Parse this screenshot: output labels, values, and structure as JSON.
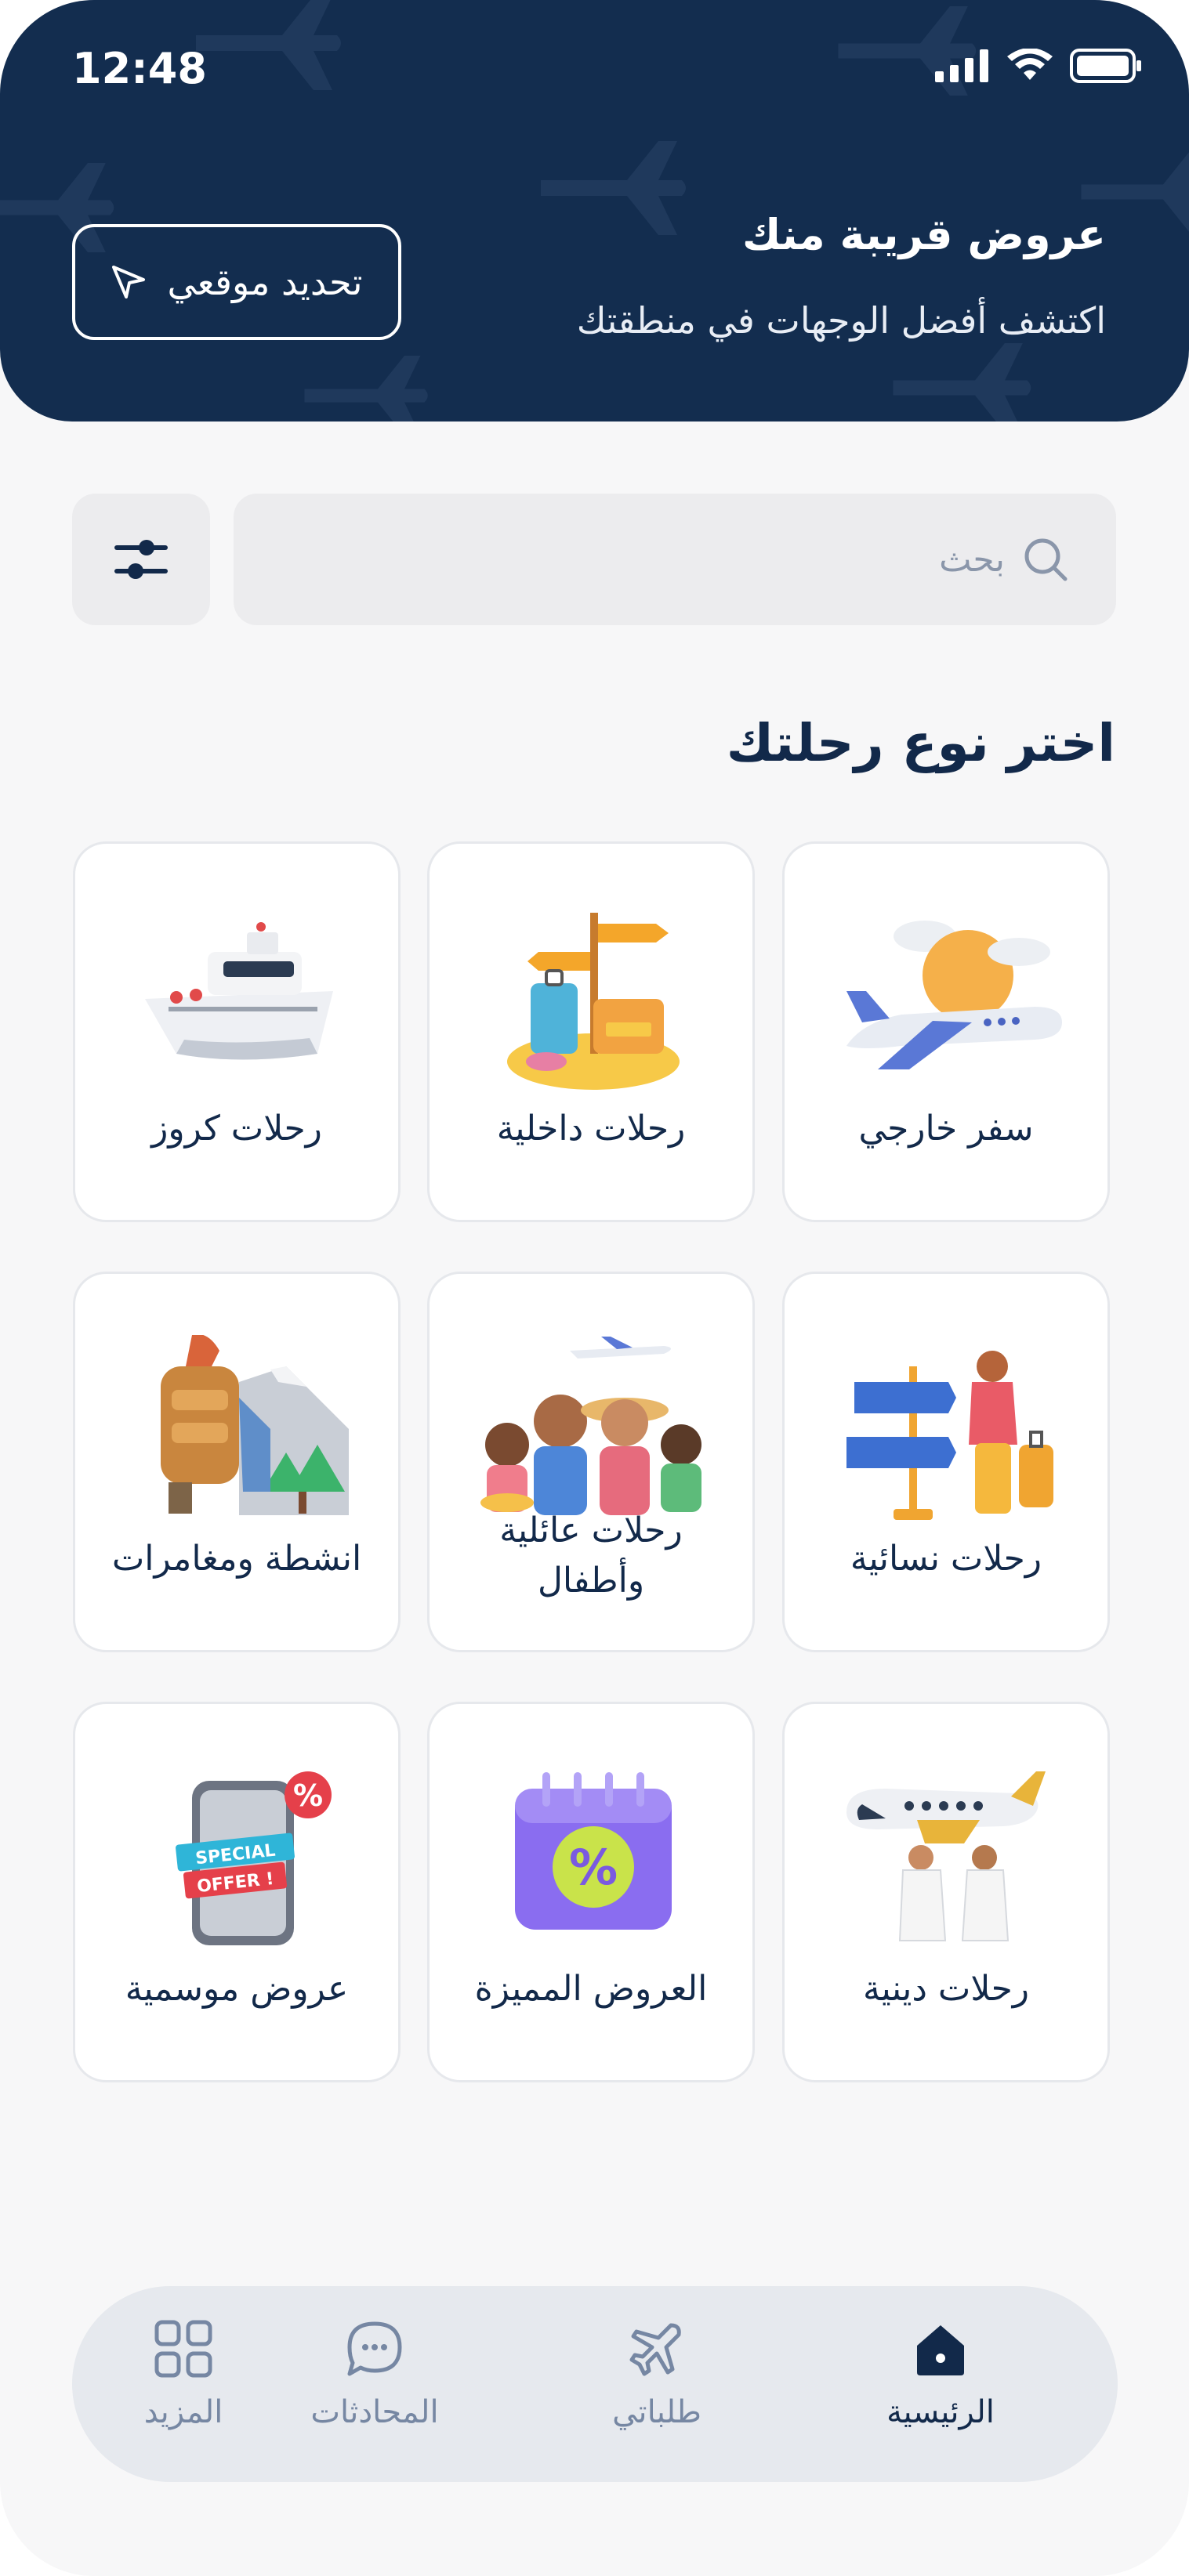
{
  "status_bar": {
    "time": "12:48"
  },
  "header": {
    "title": "عروض قريبة منك",
    "subtitle": "اكتشف أفضل الوجهات في منطقتك",
    "locate_button": "تحديد موقعي"
  },
  "search": {
    "placeholder": "بحث"
  },
  "section_title": "اختر نوع رحلتك",
  "categories": [
    {
      "label": "سفر خارجي",
      "icon": "airplane-icon"
    },
    {
      "label": "رحلات داخلية",
      "icon": "luggage-signpost-icon"
    },
    {
      "label": "رحلات كروز",
      "icon": "cruise-ship-icon"
    },
    {
      "label": "رحلات نسائية",
      "icon": "woman-traveler-icon"
    },
    {
      "label_line1": "رحلات عائلية",
      "label_line2": "وأطفال",
      "icon": "family-icon"
    },
    {
      "label": "انشطة ومغامرات",
      "icon": "hiker-backpack-icon"
    },
    {
      "label": "رحلات دينية",
      "icon": "pilgrims-plane-icon"
    },
    {
      "label": "العروض المميزة",
      "icon": "discount-calendar-icon"
    },
    {
      "label": "عروض موسمية",
      "icon": "special-offer-phone-icon",
      "badge_text": "SPECIAL OFFER !"
    }
  ],
  "bottom_nav": [
    {
      "label": "الرئيسية",
      "icon": "home-icon",
      "active": true
    },
    {
      "label": "طلباتي",
      "icon": "plane-icon",
      "active": false
    },
    {
      "label": "المحادثات",
      "icon": "chat-icon",
      "active": false
    },
    {
      "label": "المزيد",
      "icon": "grid-icon",
      "active": false
    }
  ],
  "colors": {
    "primary": "#132d4f",
    "background": "#f7f7f8",
    "nav_inactive": "#7687a3"
  }
}
